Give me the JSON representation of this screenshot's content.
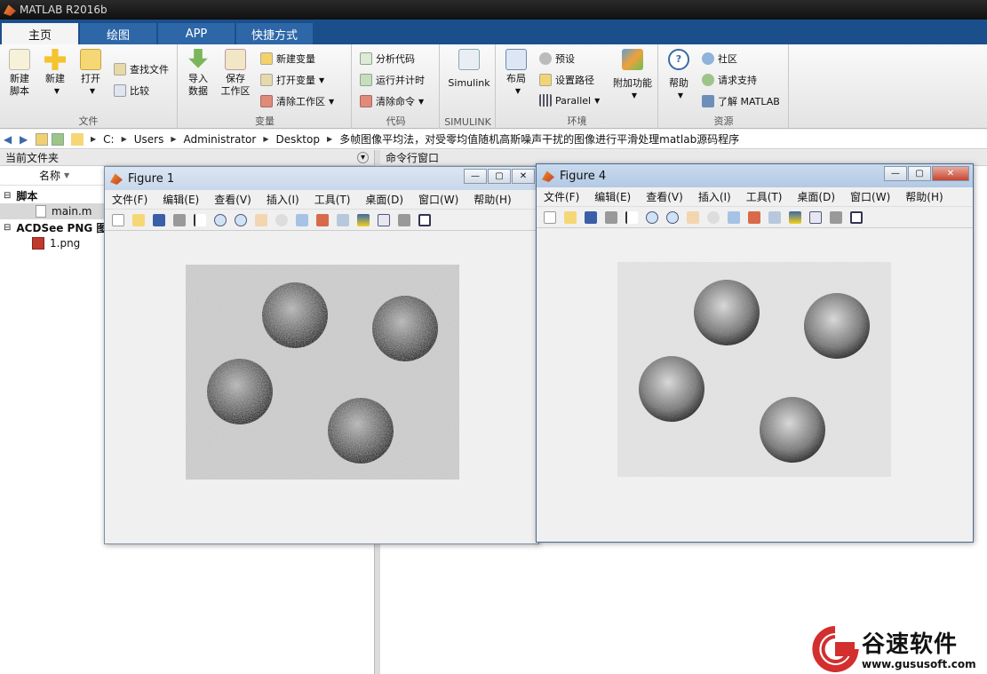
{
  "app": {
    "title": "MATLAB R2016b"
  },
  "tabs": [
    {
      "label": "主页"
    },
    {
      "label": "绘图"
    },
    {
      "label": "APP"
    },
    {
      "label": "快捷方式"
    }
  ],
  "ribbon": {
    "file_group": {
      "label": "文件",
      "new_script": "新建\n脚本",
      "new": "新建",
      "open": "打开",
      "find_files": "查找文件",
      "compare": "比较"
    },
    "variable_group": {
      "label": "变量",
      "import": "导入\n数据",
      "save_ws": "保存\n工作区",
      "new_var": "新建变量",
      "open_var": "打开变量",
      "clear_ws": "清除工作区"
    },
    "code_group": {
      "label": "代码",
      "analyze": "分析代码",
      "run_time": "运行并计时",
      "clear_cmd": "清除命令"
    },
    "simulink_group": {
      "label": "SIMULINK",
      "simulink": "Simulink"
    },
    "env_group": {
      "label": "环境",
      "layout": "布局",
      "prefs": "预设",
      "set_path": "设置路径",
      "parallel": "Parallel",
      "addons": "附加功能"
    },
    "resources_group": {
      "label": "资源",
      "help": "帮助",
      "community": "社区",
      "support": "请求支持",
      "learn": "了解 MATLAB"
    }
  },
  "address": {
    "crumbs": [
      "C:",
      "Users",
      "Administrator",
      "Desktop",
      "多帧图像平均法，对受零均值随机高斯噪声干扰的图像进行平滑处理matlab源码程序"
    ]
  },
  "file_panel": {
    "title": "当前文件夹",
    "col_name": "名称",
    "group_script": "脚本",
    "file_main": "main.m",
    "group_png": "ACDSee PNG 图像",
    "file_png": "1.png"
  },
  "cmd_panel": {
    "title": "命令行窗口"
  },
  "figure1": {
    "title": "Figure 1",
    "menu": [
      "文件(F)",
      "编辑(E)",
      "查看(V)",
      "插入(I)",
      "工具(T)",
      "桌面(D)",
      "窗口(W)",
      "帮助(H)"
    ]
  },
  "figure4": {
    "title": "Figure 4",
    "menu": [
      "文件(F)",
      "编辑(E)",
      "查看(V)",
      "插入(I)",
      "工具(T)",
      "桌面(D)",
      "窗口(W)",
      "帮助(H)"
    ]
  },
  "watermark": {
    "brand": "谷速软件",
    "url": "www.gususoft.com"
  }
}
